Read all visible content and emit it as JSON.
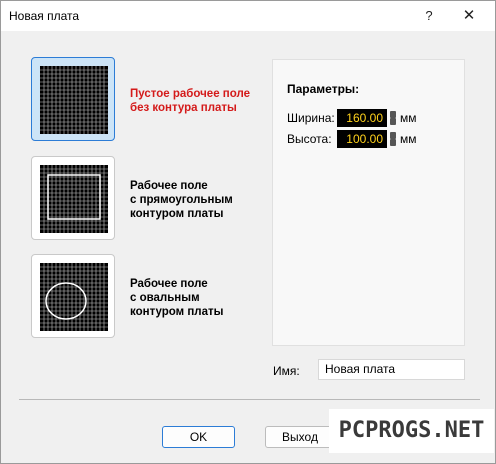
{
  "window": {
    "title": "Новая плата",
    "help_glyph": "?",
    "close_glyph": "✕"
  },
  "options": [
    {
      "label": "Пустое рабочее поле\nбез контура платы",
      "icon": "empty-grid-icon",
      "selected": true
    },
    {
      "label": "Рабочее поле\nс прямоугольным\nконтуром платы",
      "icon": "rect-contour-grid-icon",
      "selected": false
    },
    {
      "label": "Рабочее поле\nс овальным\nконтуром платы",
      "icon": "oval-contour-grid-icon",
      "selected": false
    }
  ],
  "params": {
    "title": "Параметры:",
    "width_label": "Ширина:",
    "width_value": "160.00",
    "height_label": "Высота:",
    "height_value": "100.00",
    "unit": "мм"
  },
  "name": {
    "label": "Имя:",
    "value": "Новая плата"
  },
  "buttons": {
    "ok": "OK",
    "exit": "Выход"
  },
  "watermark": "PCPROGS.NET",
  "colors": {
    "selected_bg": "#cce4f7",
    "selected_border": "#2c7cd6",
    "selected_label": "#d41a1a",
    "number_fg": "#ffd21c",
    "number_bg": "#000000"
  }
}
